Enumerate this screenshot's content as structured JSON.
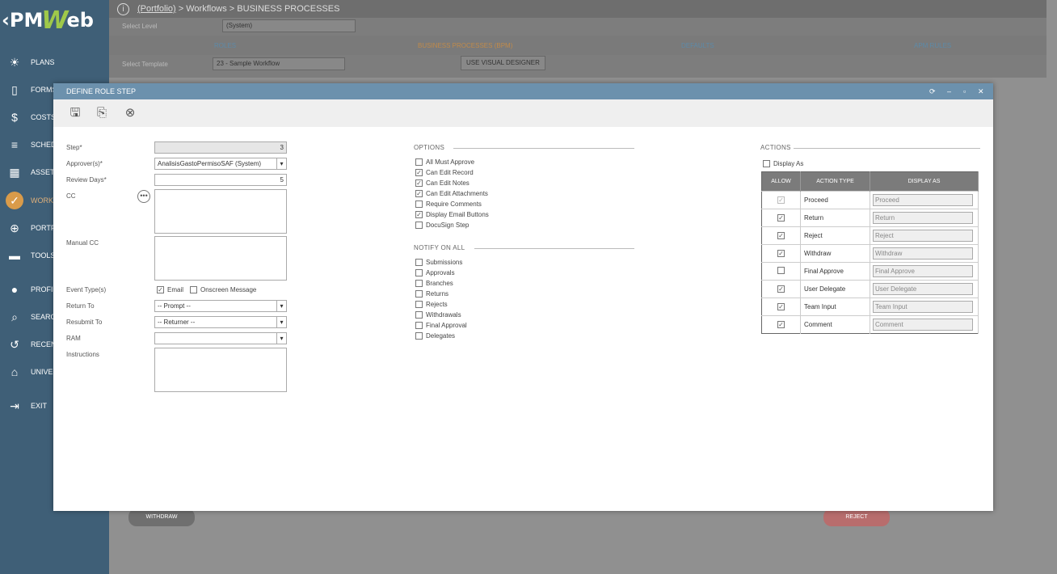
{
  "app": {
    "logo_left": "‹PM",
    "logo_mid": "W",
    "logo_right": "eb"
  },
  "sidebar": {
    "items": [
      {
        "label": "PLANS",
        "icon": "lightbulb-icon",
        "glyph": "☀"
      },
      {
        "label": "FORMS",
        "icon": "document-icon",
        "glyph": "▯"
      },
      {
        "label": "COSTS",
        "icon": "dollar-icon",
        "glyph": "$"
      },
      {
        "label": "SCHED",
        "icon": "schedule-icon",
        "glyph": "≡"
      },
      {
        "label": "ASSET",
        "icon": "building-icon",
        "glyph": "▦"
      },
      {
        "label": "WORK",
        "icon": "check-icon",
        "glyph": "✓"
      },
      {
        "label": "PORTF",
        "icon": "globe-icon",
        "glyph": "⊕"
      },
      {
        "label": "TOOLS",
        "icon": "toolbox-icon",
        "glyph": "▬"
      },
      {
        "label": "PROFI",
        "icon": "user-icon",
        "glyph": "●"
      },
      {
        "label": "SEARC",
        "icon": "search-icon",
        "glyph": "⌕"
      },
      {
        "label": "RECEN",
        "icon": "history-icon",
        "glyph": "↺"
      },
      {
        "label": "UNIVE",
        "icon": "graduation-icon",
        "glyph": "⌂"
      },
      {
        "label": "EXIT",
        "icon": "exit-icon",
        "glyph": "⇥"
      }
    ]
  },
  "topbar": {
    "info_glyph": "i",
    "portfolio": "(Portfolio)",
    "rest": " > Workflows > BUSINESS PROCESSES"
  },
  "background": {
    "select_level_label": "Select Level",
    "select_level_value": "(System)",
    "tabs": [
      "ROLES",
      "BUSINESS PROCESSES (BPM)",
      "DEFAULTS",
      "APM RULES"
    ],
    "select_template_label": "Select Template",
    "select_template_value": "23 - Sample Workflow",
    "visual_designer": "USE VISUAL DESIGNER",
    "withdraw": "WITHDRAW",
    "reject": "REJECT"
  },
  "modal": {
    "title": "DEFINE ROLE STEP",
    "labels": {
      "step": "Step*",
      "approvers": "Approver(s)*",
      "review_days": "Review Days*",
      "cc": "CC",
      "manual_cc": "Manual CC",
      "event_types": "Event Type(s)",
      "return_to": "Return To",
      "resubmit_to": "Resubmit To",
      "ram": "RAM",
      "instructions": "Instructions"
    },
    "values": {
      "step": "3",
      "approvers": "AnalisisGastoPermisoSAF (System)",
      "review_days": "5",
      "return_to": "-- Prompt --",
      "resubmit_to": "-- Returner --",
      "ram": ""
    },
    "event_email": "Email",
    "event_onscreen": "Onscreen Message",
    "options_title": "OPTIONS",
    "options": [
      {
        "label": "All Must Approve",
        "checked": false
      },
      {
        "label": "Can Edit Record",
        "checked": true
      },
      {
        "label": "Can Edit Notes",
        "checked": true
      },
      {
        "label": "Can Edit Attachments",
        "checked": true
      },
      {
        "label": "Require Comments",
        "checked": false
      },
      {
        "label": "Display Email Buttons",
        "checked": true
      },
      {
        "label": "DocuSign Step",
        "checked": false
      }
    ],
    "notify_title": "NOTIFY ON ALL",
    "notify": [
      "Submissions",
      "Approvals",
      "Branches",
      "Returns",
      "Rejects",
      "Withdrawals",
      "Final Approval",
      "Delegates"
    ],
    "actions_title": "ACTIONS",
    "display_as_label": "Display As",
    "table_headers": [
      "ALLOW",
      "ACTION TYPE",
      "DISPLAY AS"
    ],
    "actions": [
      {
        "type": "Proceed",
        "display": "Proceed",
        "allow": true,
        "locked": true
      },
      {
        "type": "Return",
        "display": "Return",
        "allow": true,
        "locked": false
      },
      {
        "type": "Reject",
        "display": "Reject",
        "allow": true,
        "locked": false
      },
      {
        "type": "Withdraw",
        "display": "Withdraw",
        "allow": true,
        "locked": false
      },
      {
        "type": "Final Approve",
        "display": "Final Approve",
        "allow": false,
        "locked": false
      },
      {
        "type": "User Delegate",
        "display": "User Delegate",
        "allow": true,
        "locked": false
      },
      {
        "type": "Team Input",
        "display": "Team Input",
        "allow": true,
        "locked": false
      },
      {
        "type": "Comment",
        "display": "Comment",
        "allow": true,
        "locked": false
      }
    ]
  }
}
